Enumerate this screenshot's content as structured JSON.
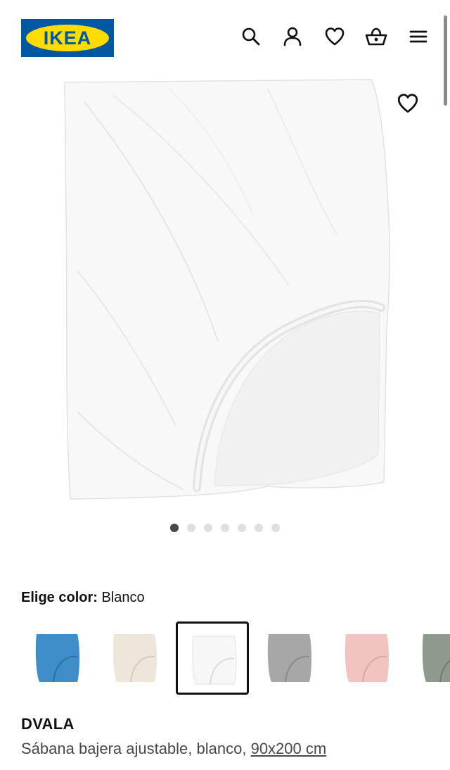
{
  "header": {
    "logo_text": "IKEA",
    "icons": [
      "search-icon",
      "user-icon",
      "heart-icon",
      "basket-icon",
      "menu-icon"
    ]
  },
  "gallery": {
    "image_count": 7,
    "active_index": 0,
    "favorite_icon": "heart-outline-icon"
  },
  "color_picker": {
    "label": "Elige color:",
    "selected_value": "Blanco",
    "swatches": [
      {
        "color": "#3f8ec9",
        "selected": false
      },
      {
        "color": "#eee6da",
        "selected": false
      },
      {
        "color": "#f7f7f7",
        "selected": true
      },
      {
        "color": "#a7a7a7",
        "selected": false
      },
      {
        "color": "#f1c4c1",
        "selected": false
      },
      {
        "color": "#8d9a8c",
        "selected": false
      }
    ]
  },
  "product": {
    "name": "DVALA",
    "description": "Sábana bajera ajustable, blanco, ",
    "size": "90x200 cm"
  },
  "colors": {
    "brand_blue": "#0058a3",
    "brand_yellow": "#ffdb00",
    "text": "#111111",
    "text_secondary": "#484848"
  }
}
